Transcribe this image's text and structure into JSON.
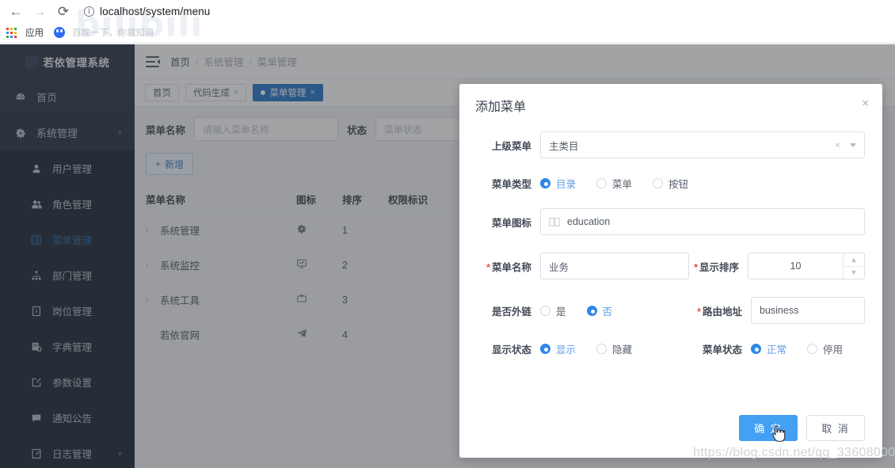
{
  "browser": {
    "url": "localhost/system/menu",
    "back_icon": "back-arrow-icon",
    "forward_icon": "forward-arrow-icon",
    "reload_icon": "reload-icon",
    "info_icon": "info-circle-icon",
    "bookmarks": [
      {
        "label": "应用",
        "icon": "apps-grid-icon"
      },
      {
        "label": "百度一下，你就知道",
        "icon": "baidu-icon"
      }
    ],
    "watermark": "bilibili"
  },
  "sidebar": {
    "brand": "若依管理系统",
    "items": [
      {
        "label": "首页",
        "icon": "dashboard-icon",
        "type": "item"
      },
      {
        "label": "系统管理",
        "icon": "gear-icon",
        "type": "group",
        "expanded": true,
        "caret": "˄"
      }
    ],
    "submenu": [
      {
        "label": "用户管理",
        "icon": "user-icon",
        "active": false
      },
      {
        "label": "角色管理",
        "icon": "users-icon",
        "active": false
      },
      {
        "label": "菜单管理",
        "icon": "menu-list-icon",
        "active": true
      },
      {
        "label": "部门管理",
        "icon": "sitemap-icon",
        "active": false
      },
      {
        "label": "岗位管理",
        "icon": "post-icon",
        "active": false
      },
      {
        "label": "字典管理",
        "icon": "dictionary-icon",
        "active": false
      },
      {
        "label": "参数设置",
        "icon": "edit-square-icon",
        "active": false
      },
      {
        "label": "通知公告",
        "icon": "comment-icon",
        "active": false
      },
      {
        "label": "日志管理",
        "icon": "log-icon",
        "active": false,
        "caret": "˅"
      }
    ]
  },
  "topbar": {
    "menu_toggle_icon": "hamburger-collapse-icon",
    "breadcrumb": [
      "首页",
      "系统管理",
      "菜单管理"
    ],
    "separator": "/"
  },
  "tabs": [
    {
      "label": "首页",
      "active": false,
      "closable": false
    },
    {
      "label": "代码生成",
      "active": false,
      "closable": true,
      "close": "×"
    },
    {
      "label": "菜单管理",
      "active": true,
      "closable": true,
      "close": "×"
    }
  ],
  "filter": {
    "name_label": "菜单名称",
    "name_placeholder": "请输入菜单名称",
    "status_label": "状态",
    "status_placeholder": "菜单状态"
  },
  "toolbar": {
    "add_label": "新增",
    "add_icon": "plus-icon"
  },
  "table": {
    "columns": [
      "菜单名称",
      "图标",
      "排序",
      "权限标识"
    ],
    "rows": [
      {
        "name": "系统管理",
        "icon": "gear-icon",
        "order": "1",
        "perm": "",
        "expandable": true,
        "expander": "›"
      },
      {
        "name": "系统监控",
        "icon": "monitor-icon",
        "order": "2",
        "perm": "",
        "expandable": true,
        "expander": "›"
      },
      {
        "name": "系统工具",
        "icon": "briefcase-icon",
        "order": "3",
        "perm": "",
        "expandable": true,
        "expander": "›"
      },
      {
        "name": "若依官网",
        "icon": "send-icon",
        "order": "4",
        "perm": "",
        "expandable": false,
        "expander": ""
      }
    ]
  },
  "modal": {
    "title": "添加菜单",
    "close_icon": "×",
    "parent": {
      "label": "上级菜单",
      "value": "主类目",
      "clear_icon": "×",
      "dropdown_icon": "chevron-down-icon"
    },
    "menu_type": {
      "label": "菜单类型",
      "options": [
        {
          "label": "目录",
          "selected": true
        },
        {
          "label": "菜单",
          "selected": false
        },
        {
          "label": "按钮",
          "selected": false
        }
      ]
    },
    "menu_icon": {
      "label": "菜单图标",
      "value": "education",
      "icon": "book-icon"
    },
    "menu_name": {
      "label": "菜单名称",
      "required": "*",
      "value": "业务"
    },
    "order_num": {
      "label": "显示排序",
      "required": "*",
      "value": "10",
      "up_icon": "chevron-up-icon",
      "down_icon": "chevron-down-icon"
    },
    "is_frame": {
      "label": "是否外链",
      "options": [
        {
          "label": "是",
          "selected": false
        },
        {
          "label": "否",
          "selected": true
        }
      ]
    },
    "path": {
      "label": "路由地址",
      "required": "*",
      "value": "business"
    },
    "visible": {
      "label": "显示状态",
      "options": [
        {
          "label": "显示",
          "selected": true
        },
        {
          "label": "隐藏",
          "selected": false
        }
      ]
    },
    "status": {
      "label": "菜单状态",
      "options": [
        {
          "label": "正常",
          "selected": true
        },
        {
          "label": "停用",
          "selected": false
        }
      ]
    },
    "confirm_label": "确 定",
    "cancel_label": "取 消"
  },
  "watermark": "https://blog.csdn.net/qq_33608000",
  "colors": {
    "sidebar_bg": "#202b3d",
    "submenu_bg": "#151e2c",
    "accent": "#1b6fc4",
    "primary_button": "#44a0f3",
    "radio_active": "#2f86e8",
    "required": "#e35050"
  }
}
